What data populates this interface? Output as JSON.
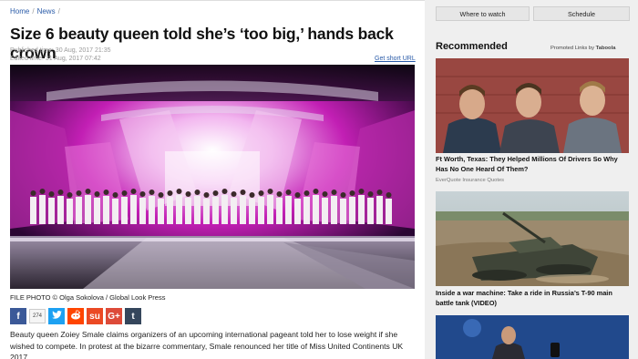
{
  "breadcrumb": {
    "home": "Home",
    "section": "News"
  },
  "article": {
    "headline": "Size 6 beauty queen told she’s ‘too big,’ hands back crown",
    "published": "Published time: 30 Aug, 2017 21:35",
    "edited": "Edited time: 31 Aug, 2017 07:42",
    "short_url": "Get short URL",
    "caption": "FILE PHOTO © Olga Sokolova / Global Look Press",
    "share_count": "274",
    "body": "Beauty queen Zoiey Smale claims organizers of an upcoming international pageant told her to lose weight if she wished to compete. In protest at the bizarre commentary, Smale renounced her title of Miss United Continents UK 2017."
  },
  "social": [
    {
      "glyph": "f",
      "color": "#3b5998",
      "name": "facebook"
    },
    {
      "glyph": "t",
      "color": "#1da1f2",
      "name": "twitter"
    },
    {
      "glyph": "r",
      "color": "#ff4500",
      "name": "reddit"
    },
    {
      "glyph": "su",
      "color": "#eb4924",
      "name": "stumbleupon"
    },
    {
      "glyph": "G+",
      "color": "#dd4b39",
      "name": "google-plus"
    },
    {
      "glyph": "t",
      "color": "#35465c",
      "name": "tumblr"
    }
  ],
  "sidebar": {
    "buttons": [
      "Where to watch",
      "Schedule"
    ],
    "recommended": "Recommended",
    "promoted_prefix": "Promoted Links by ",
    "promoted_brand": "Taboola",
    "ads": [
      {
        "title": "Ft Worth, Texas: They Helped Millions Of Drivers So Why Has No One Heard Of Them?",
        "source": "EverQuote Insurance Quotes"
      },
      {
        "title": "Inside a war machine: Take a ride in Russia’s T-90 main battle tank (VIDEO)",
        "source": ""
      }
    ]
  },
  "colors": {
    "link": "#2a5ba8",
    "stage_magenta": "#c21fb4",
    "sidebar_bg": "#efefef"
  }
}
